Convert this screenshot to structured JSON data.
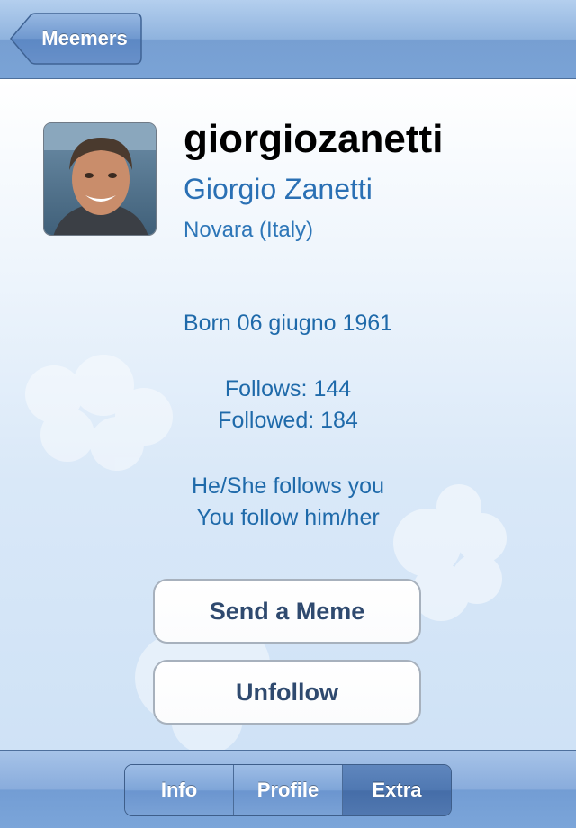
{
  "nav": {
    "back_label": "Meemers"
  },
  "profile": {
    "username": "giorgiozanetti",
    "full_name": "Giorgio Zanetti",
    "location": "Novara (Italy)",
    "born": "Born 06 giugno 1961",
    "follows": "Follows: 144",
    "followed": "Followed: 184",
    "relation_1": "He/She follows you",
    "relation_2": "You follow him/her"
  },
  "actions": {
    "send_meme": "Send a Meme",
    "unfollow": "Unfollow"
  },
  "tabs": [
    {
      "label": "Info",
      "selected": false
    },
    {
      "label": "Profile",
      "selected": false
    },
    {
      "label": "Extra",
      "selected": true
    }
  ],
  "colors": {
    "accent": "#2a70b4",
    "nav": "#8fb3de",
    "button_text": "#2f4a6f"
  }
}
